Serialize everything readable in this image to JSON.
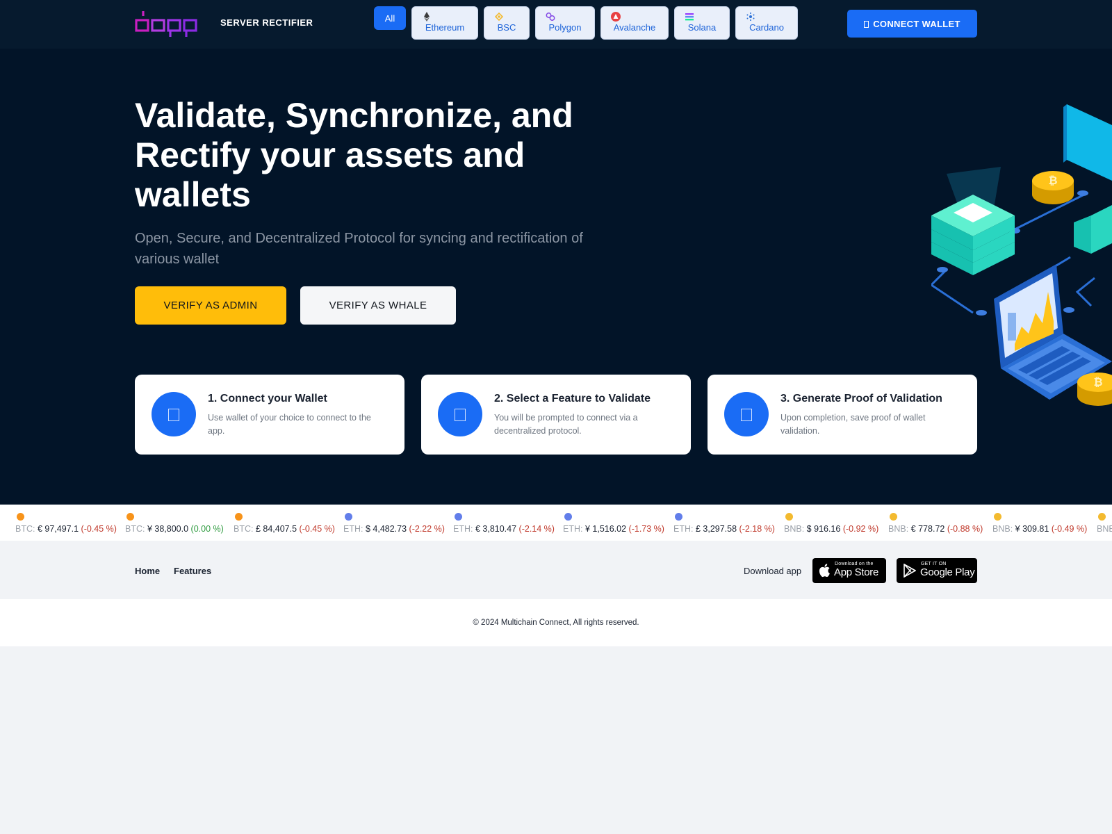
{
  "header": {
    "brand_logo_text": "dapp",
    "brand_text": "SERVER RECTIFIER",
    "chains": [
      {
        "label": "All",
        "active": true
      },
      {
        "label": "Ethereum",
        "icon": "ethereum-icon",
        "color": "#3c3c3d"
      },
      {
        "label": "BSC",
        "icon": "bsc-icon",
        "color": "#f3ba2f"
      },
      {
        "label": "Polygon",
        "icon": "polygon-icon",
        "color": "#8247e5"
      },
      {
        "label": "Avalanche",
        "icon": "avalanche-icon",
        "color": "#e84142"
      },
      {
        "label": "Solana",
        "icon": "solana-icon",
        "color": "#14f195"
      },
      {
        "label": "Cardano",
        "icon": "cardano-icon",
        "color": "#0033ad"
      }
    ],
    "connect_label": "CONNECT WALLET"
  },
  "hero": {
    "headline": "Validate, Synchronize, and Rectify your assets and wallets",
    "subline": "Open, Secure, and Decentralized Protocol for syncing and rectification of various wallet",
    "admin_label": "VERIFY AS ADMIN",
    "whale_label": "VERIFY AS WHALE"
  },
  "steps": [
    {
      "title": "1. Connect your Wallet",
      "desc": "Use wallet of your choice to connect to the app."
    },
    {
      "title": "2. Select a Feature to Validate",
      "desc": "You will be prompted to connect via a decentralized protocol."
    },
    {
      "title": "3. Generate Proof of Validation",
      "desc": "Upon completion, save proof of wallet validation."
    }
  ],
  "ticker": [
    {
      "sym": "BTC:",
      "val": "€ 97,497.1",
      "chg": "(-0.45 %)",
      "dir": "neg",
      "coin": "#f7931a"
    },
    {
      "sym": "BTC:",
      "val": "¥ 38,800.0",
      "chg": "(0.00 %)",
      "dir": "pos",
      "coin": "#f7931a"
    },
    {
      "sym": "BTC:",
      "val": "£ 84,407.5",
      "chg": "(-0.45 %)",
      "dir": "neg",
      "coin": "#f7931a"
    },
    {
      "sym": "ETH:",
      "val": "$ 4,482.73",
      "chg": "(-2.22 %)",
      "dir": "neg",
      "coin": "#627eea"
    },
    {
      "sym": "ETH:",
      "val": "€ 3,810.47",
      "chg": "(-2.14 %)",
      "dir": "neg",
      "coin": "#627eea"
    },
    {
      "sym": "ETH:",
      "val": "¥ 1,516.02",
      "chg": "(-1.73 %)",
      "dir": "neg",
      "coin": "#627eea"
    },
    {
      "sym": "ETH:",
      "val": "£ 3,297.58",
      "chg": "(-2.18 %)",
      "dir": "neg",
      "coin": "#627eea"
    },
    {
      "sym": "BNB:",
      "val": "$ 916.16",
      "chg": "(-0.92 %)",
      "dir": "neg",
      "coin": "#f3ba2f"
    },
    {
      "sym": "BNB:",
      "val": "€ 778.72",
      "chg": "(-0.88 %)",
      "dir": "neg",
      "coin": "#f3ba2f"
    },
    {
      "sym": "BNB:",
      "val": "¥ 309.81",
      "chg": "(-0.49 %)",
      "dir": "neg",
      "coin": "#f3ba2f"
    }
  ],
  "footer": {
    "links": [
      "Home",
      "Features"
    ],
    "download_label": "Download app",
    "app_store_small": "Download on the",
    "app_store_big": "App Store",
    "google_play_small": "GET IT ON",
    "google_play_big": "Google Play",
    "copyright": "© 2024 Multichain Connect, All rights reserved."
  },
  "colors": {
    "background_dark": "#021428",
    "accent_blue": "#1a6cf5",
    "accent_yellow": "#ffbd0a",
    "brand_logo": "#d81bb0"
  }
}
